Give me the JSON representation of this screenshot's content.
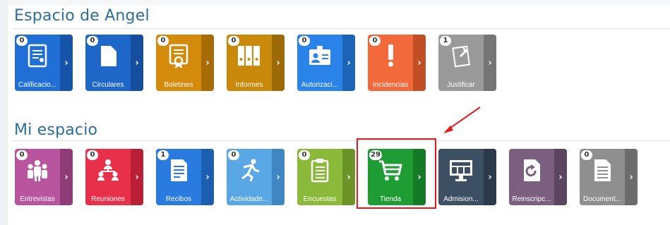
{
  "sections": {
    "angel": {
      "title": "Espacio de Angel",
      "tiles": [
        {
          "label": "Calificacio...",
          "badge": "0",
          "icon": "certificate-icon",
          "color": "#1f6fd6",
          "dark": "#1554a8"
        },
        {
          "label": "Circulares",
          "badge": "0",
          "icon": "document-icon",
          "color": "#1e67c9",
          "dark": "#154e9c"
        },
        {
          "label": "Boletines",
          "badge": "0",
          "icon": "award-icon",
          "color": "#d48b0c",
          "dark": "#a86c06"
        },
        {
          "label": "Informes",
          "badge": "0",
          "icon": "binders-icon",
          "color": "#c98a0c",
          "dark": "#9c6a06"
        },
        {
          "label": "Autorizaci...",
          "badge": "0",
          "icon": "id-card-icon",
          "color": "#2a83e8",
          "dark": "#1c64b8"
        },
        {
          "label": "Incidencias",
          "badge": "0",
          "icon": "exclamation-icon",
          "color": "#f26a3b",
          "dark": "#c24e24"
        },
        {
          "label": "Justificar",
          "badge": "1",
          "icon": "pin-note-icon",
          "color": "#9a9a9a",
          "dark": "#757575"
        }
      ]
    },
    "mine": {
      "title": "Mi espacio",
      "tiles": [
        {
          "label": "Entrevistas",
          "badge": "0",
          "icon": "group-icon",
          "color": "#b9549e",
          "dark": "#8f3c79"
        },
        {
          "label": "Reuniones",
          "badge": "0",
          "icon": "org-chart-icon",
          "color": "#e8304b",
          "dark": "#b92036"
        },
        {
          "label": "Recibos",
          "badge": "1",
          "icon": "receipt-icon",
          "color": "#2a7be0",
          "dark": "#1c5fb0"
        },
        {
          "label": "Actividade...",
          "badge": "0",
          "icon": "runner-icon",
          "color": "#5aa7e6",
          "dark": "#3f86c2"
        },
        {
          "label": "Encuestas",
          "badge": "0",
          "icon": "clipboard-icon",
          "color": "#8bb93a",
          "dark": "#6b9327"
        },
        {
          "label": "Tienda",
          "badge": "29",
          "icon": "cart-icon",
          "color": "#1f9d34",
          "dark": "#147a26"
        },
        {
          "label": "Admision...",
          "badge": "",
          "icon": "monitor-icon",
          "color": "#3c4f63",
          "dark": "#2c3b4b"
        },
        {
          "label": "Reinscripc...",
          "badge": "",
          "icon": "refresh-doc-icon",
          "color": "#7a5f7f",
          "dark": "#5b4560"
        },
        {
          "label": "Document...",
          "badge": "0",
          "icon": "documents-icon",
          "color": "#8f8f8f",
          "dark": "#6c6c6c"
        }
      ]
    }
  }
}
